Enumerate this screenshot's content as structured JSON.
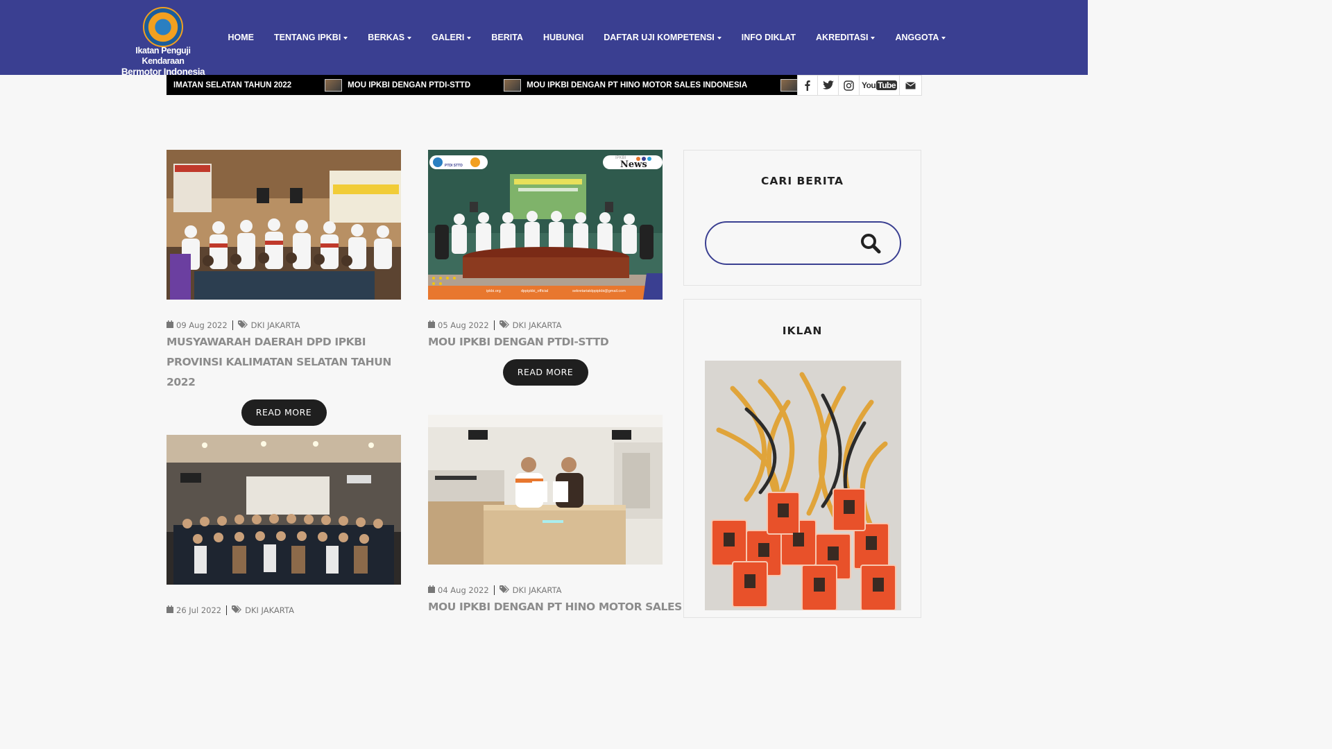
{
  "header": {
    "logo_text_line1": "Ikatan Penguji Kendaraan",
    "logo_text_line2": "Bermotor Indonesia",
    "nav": [
      {
        "label": "HOME",
        "dropdown": false
      },
      {
        "label": "TENTANG IPKBI",
        "dropdown": true
      },
      {
        "label": "BERKAS",
        "dropdown": true
      },
      {
        "label": "GALERI",
        "dropdown": true
      },
      {
        "label": "BERITA",
        "dropdown": false
      },
      {
        "label": "HUBUNGI",
        "dropdown": false
      },
      {
        "label": "DAFTAR UJI KOMPETENSI",
        "dropdown": true
      },
      {
        "label": "INFO DIKLAT",
        "dropdown": false
      },
      {
        "label": "AKREDITASI",
        "dropdown": true
      },
      {
        "label": "ANGGOTA",
        "dropdown": true
      }
    ]
  },
  "ticker": {
    "items": [
      "IMATAN SELATAN TAHUN 2022",
      "MOU IPKBI DENGAN PTDI-STTD",
      "MOU IPKBI DENGAN PT HINO MOTOR SALES INDONESIA"
    ]
  },
  "social": {
    "icons": [
      "facebook-icon",
      "twitter-icon",
      "instagram-icon",
      "youtube-icon",
      "email-icon"
    ],
    "youtube_label": "YouTube"
  },
  "posts": [
    {
      "date": "09 Aug 2022",
      "category": "DKI JAKARTA",
      "title": "MUSYAWARAH DAERAH DPD IPKBI PROVINSI KALIMATAN SELATAN TAHUN 2022",
      "read_more": "READ MORE"
    },
    {
      "date": "05 Aug 2022",
      "category": "DKI JAKARTA",
      "title": "MOU IPKBI DENGAN PTDI-STTD",
      "read_more": "READ MORE",
      "image_texts": {
        "badge": "PTDI STTD",
        "news_tag": "IPKBI",
        "news_word": "News",
        "footer_site": "ipkbi.org",
        "footer_ig": "dppipkbi_official",
        "footer_mail": "sekretariatdppipkbi@gmail.com"
      }
    },
    {
      "date": "26 Jul 2022",
      "category": "DKI JAKARTA",
      "title": ""
    },
    {
      "date": "04 Aug 2022",
      "category": "DKI JAKARTA",
      "title": "MOU IPKBI DENGAN PT HINO MOTOR SALES"
    }
  ],
  "sidebar": {
    "search_title": "CARI BERITA",
    "search_placeholder": "",
    "ad_title": "IKLAN"
  },
  "colors": {
    "header_bg": "#3a3f91",
    "accent": "#3a3f91",
    "button_bg": "#1f1f1f",
    "ticker_bg": "#000000"
  }
}
